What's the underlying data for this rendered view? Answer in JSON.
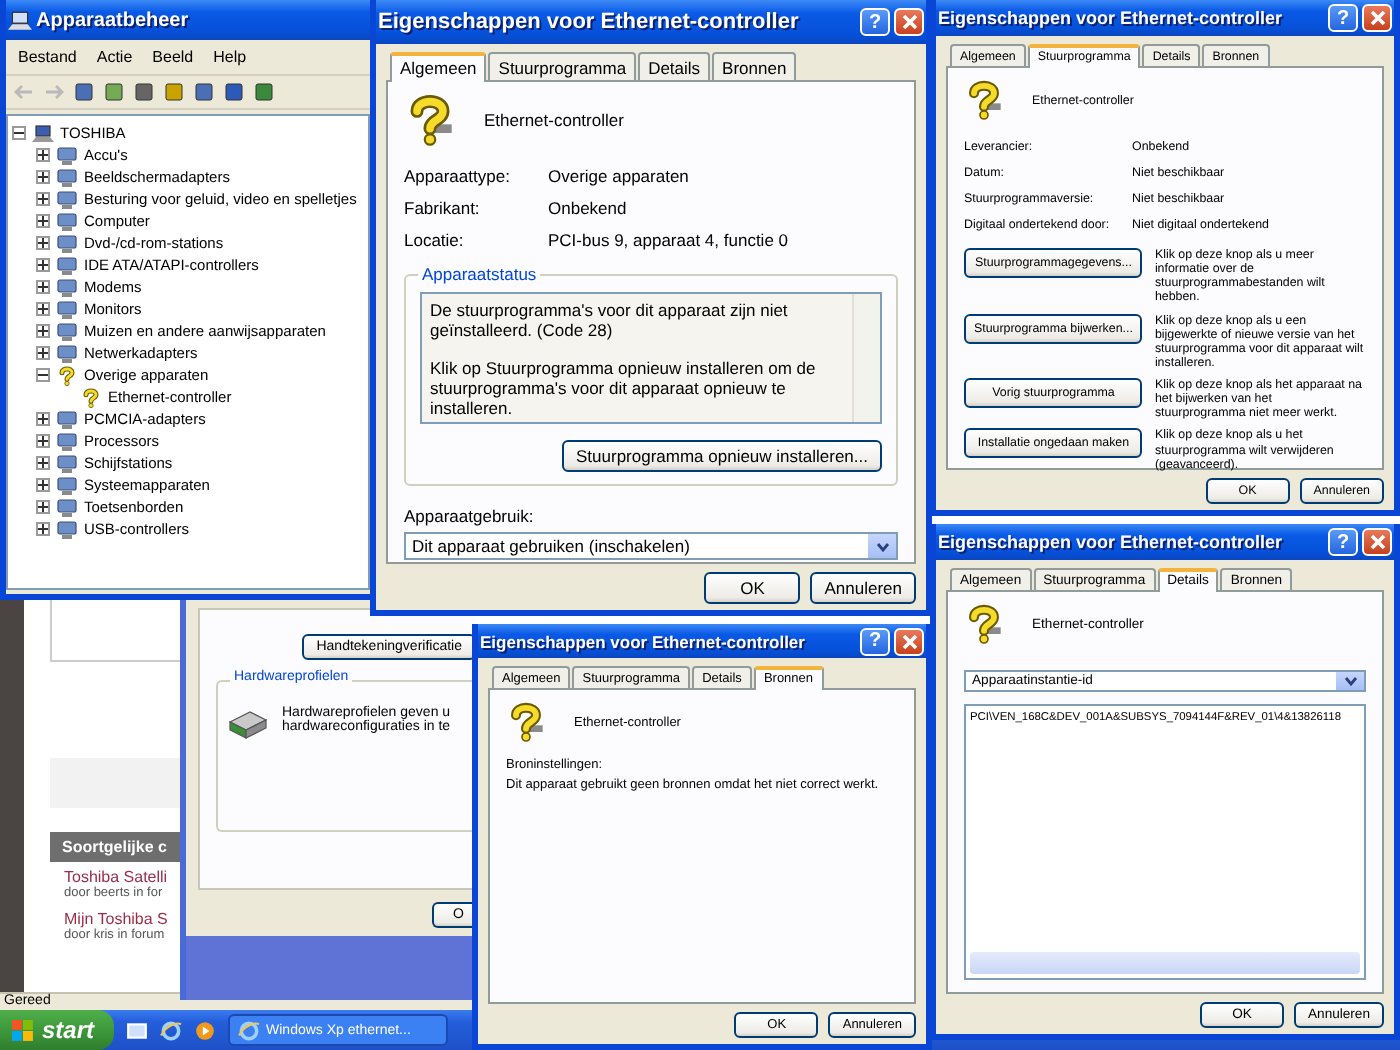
{
  "browser": {
    "section_title": "Soortgelijke c",
    "threads": [
      {
        "title": "Toshiba Satelli",
        "meta": "door beerts in for"
      },
      {
        "title": "Mijn Toshiba S",
        "meta": "door kris in forum"
      }
    ],
    "status": "Gereed"
  },
  "system_properties": {
    "signature_button": "Handtekeningverificatie",
    "group_title": "Hardwareprofielen",
    "group_lines": [
      "Hardwareprofielen geven u",
      "hardwareconfiguraties in te"
    ],
    "ok_button": "O"
  },
  "taskbar": {
    "start": "start",
    "tasks": [
      {
        "label": "Windows Xp ethernet...",
        "selected": false
      }
    ]
  },
  "device_manager": {
    "title": "Apparaatbeheer",
    "menu": [
      "Bestand",
      "Actie",
      "Beeld",
      "Help"
    ],
    "tree": {
      "label": "TOSHIBA",
      "kind": "computer",
      "expanded": true,
      "children": [
        {
          "label": "Accu's",
          "kind": "device",
          "expanded": false
        },
        {
          "label": "Beeldschermadapters",
          "kind": "device",
          "expanded": false
        },
        {
          "label": "Besturing voor geluid, video en spelletjes",
          "kind": "device",
          "expanded": false
        },
        {
          "label": "Computer",
          "kind": "device",
          "expanded": false
        },
        {
          "label": "Dvd-/cd-rom-stations",
          "kind": "device",
          "expanded": false
        },
        {
          "label": "IDE ATA/ATAPI-controllers",
          "kind": "device",
          "expanded": false
        },
        {
          "label": "Modems",
          "kind": "device",
          "expanded": false
        },
        {
          "label": "Monitors",
          "kind": "device",
          "expanded": false
        },
        {
          "label": "Muizen en andere aanwijsapparaten",
          "kind": "device",
          "expanded": false
        },
        {
          "label": "Netwerkadapters",
          "kind": "device",
          "expanded": false
        },
        {
          "label": "Overige apparaten",
          "kind": "unknown",
          "expanded": true,
          "children": [
            {
              "label": "Ethernet-controller",
              "kind": "unknown"
            }
          ]
        },
        {
          "label": "PCMCIA-adapters",
          "kind": "device",
          "expanded": false
        },
        {
          "label": "Processors",
          "kind": "device",
          "expanded": false
        },
        {
          "label": "Schijfstations",
          "kind": "device",
          "expanded": false
        },
        {
          "label": "Systeemapparaten",
          "kind": "device",
          "expanded": false
        },
        {
          "label": "Toetsenborden",
          "kind": "device",
          "expanded": false
        },
        {
          "label": "USB-controllers",
          "kind": "device",
          "expanded": false
        }
      ]
    }
  },
  "dialogs": [
    {
      "kind": "general",
      "title": "Eigenschappen voor Ethernet-controller",
      "help_button": "?",
      "tabs": [
        {
          "label": "Algemeen",
          "selected": true
        },
        {
          "label": "Stuurprogramma",
          "selected": false
        },
        {
          "label": "Details",
          "selected": false
        },
        {
          "label": "Bronnen",
          "selected": false
        }
      ],
      "device_name": "Ethernet-controller",
      "properties": [
        {
          "label": "Apparaattype:",
          "value": "Overige apparaten"
        },
        {
          "label": "Fabrikant:",
          "value": "Onbekend"
        },
        {
          "label": "Locatie:",
          "value": "PCI-bus 9, apparaat 4, functie 0"
        }
      ],
      "status_title": "Apparaatstatus",
      "status_paragraphs": [
        "De stuurprogramma's voor dit apparaat zijn niet geïnstalleerd. (Code 28)",
        "Klik op Stuurprogramma opnieuw installeren om de stuurprogramma's voor dit apparaat opnieuw te installeren."
      ],
      "reinstall_button": "Stuurprogramma opnieuw installeren...",
      "usage_label": "Apparaatgebruik:",
      "usage_value": "Dit apparaat gebruiken (inschakelen)",
      "buttons": [
        "OK",
        "Annuleren"
      ]
    },
    {
      "kind": "driver",
      "title": "Eigenschappen voor Ethernet-controller",
      "help_button": "?",
      "tabs": [
        {
          "label": "Algemeen",
          "selected": false
        },
        {
          "label": "Stuurprogramma",
          "selected": true
        },
        {
          "label": "Details",
          "selected": false
        },
        {
          "label": "Bronnen",
          "selected": false
        }
      ],
      "device_name": "Ethernet-controller",
      "properties": [
        {
          "label": "Leverancier:",
          "value": "Onbekend"
        },
        {
          "label": "Datum:",
          "value": "Niet beschikbaar"
        },
        {
          "label": "Stuurprogrammaversie:",
          "value": "Niet beschikbaar"
        },
        {
          "label": "Digitaal ondertekend door:",
          "value": "Niet digitaal ondertekend"
        }
      ],
      "actions": [
        {
          "button": "Stuurprogrammagegevens...",
          "text": "Klik op deze knop als u meer informatie over de stuurprogrammabestanden wilt hebben."
        },
        {
          "button": "Stuurprogramma bijwerken...",
          "text": "Klik op deze knop als u een bijgewerkte of nieuwe versie van het stuurprogramma voor dit apparaat wilt installeren."
        },
        {
          "button": "Vorig stuurprogramma",
          "text": "Klik op deze knop als het apparaat na het bijwerken van het stuurprogramma niet meer werkt."
        },
        {
          "button": "Installatie ongedaan maken",
          "text": "Klik op deze knop als u het stuurprogramma wilt verwijderen (geavanceerd)."
        }
      ],
      "buttons": [
        "OK",
        "Annuleren"
      ]
    },
    {
      "kind": "details",
      "title": "Eigenschappen voor Ethernet-controller",
      "help_button": "?",
      "tabs": [
        {
          "label": "Algemeen",
          "selected": false
        },
        {
          "label": "Stuurprogramma",
          "selected": false
        },
        {
          "label": "Details",
          "selected": true
        },
        {
          "label": "Bronnen",
          "selected": false
        }
      ],
      "device_name": "Ethernet-controller",
      "property_select": "Apparaatinstantie-id",
      "values": [
        "PCI\\VEN_168C&DEV_001A&SUBSYS_7094144F&REV_01\\4&13826118"
      ],
      "buttons": [
        "OK",
        "Annuleren"
      ]
    },
    {
      "kind": "resources",
      "title": "Eigenschappen voor Ethernet-controller",
      "help_button": "?",
      "tabs": [
        {
          "label": "Algemeen",
          "selected": false
        },
        {
          "label": "Stuurprogramma",
          "selected": false
        },
        {
          "label": "Details",
          "selected": false
        },
        {
          "label": "Bronnen",
          "selected": true
        }
      ],
      "device_name": "Ethernet-controller",
      "settings_label": "Broninstellingen:",
      "settings_text": "Dit apparaat gebruikt geen bronnen omdat het niet correct werkt.",
      "buttons": [
        "OK",
        "Annuleren"
      ]
    }
  ]
}
